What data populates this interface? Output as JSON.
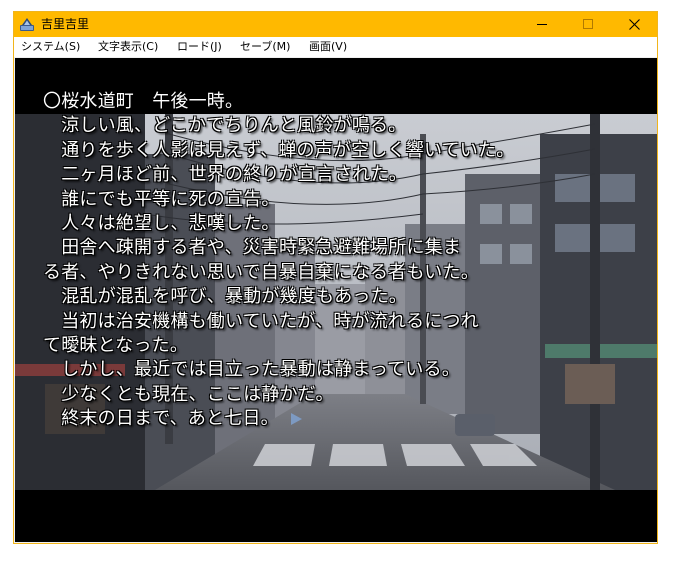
{
  "window": {
    "title": "吉里吉里",
    "accent_color": "#ffb900",
    "icon": "kirikiri-app-icon",
    "controls": [
      "minimize-icon",
      "maximize-icon",
      "close-icon"
    ]
  },
  "menubar": {
    "items": [
      {
        "label": "システム(S)"
      },
      {
        "label": "文字表示(C)"
      },
      {
        "label": "ロード(J)"
      },
      {
        "label": "セーブ(M)"
      },
      {
        "label": "画面(V)"
      }
    ]
  },
  "scene": {
    "background": "photo-street-with-utility-poles"
  },
  "message": {
    "lines": [
      "〇桜水道町　午後一時。",
      "　涼しい風、どこかでちりんと風鈴が鳴る。",
      "　通りを歩く人影は見えず、蝉の声が空しく響いていた。",
      "　二ヶ月ほど前、世界の終りが宣言された。",
      "　誰にでも平等に死の宣告。",
      "　人々は絶望し、悲嘆した。",
      "　田舎へ疎開する者や、災害時緊急避難場所に集ま",
      "る者、やりきれない思いで自暴自棄になる者もいた。",
      "　混乱が混乱を呼び、暴動が幾度もあった。",
      "　当初は治安機構も働いていたが、時が流れるにつれ",
      "て曖昧となった。",
      "　しかし、最近では目立った暴動は静まっている。",
      "　少なくとも現在、ここは静かだ。",
      "　終末の日まで、あと七日。"
    ],
    "continue_indicator": "next-page-arrow-icon"
  }
}
